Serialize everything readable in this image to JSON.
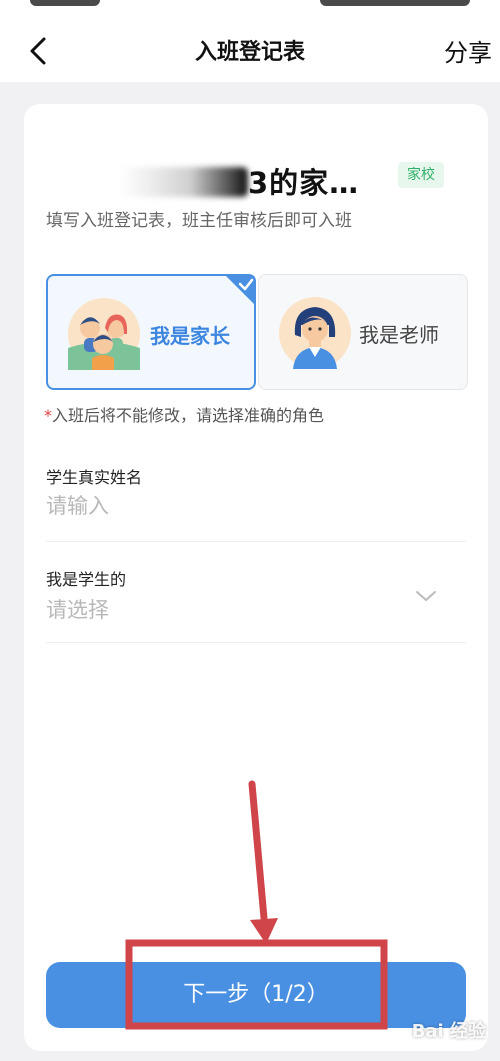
{
  "header": {
    "title": "入班登记表",
    "share_label": "分享"
  },
  "class_info": {
    "name_visible": "3的家…",
    "badge": "家校",
    "subtitle": "填写入班登记表，班主任审核后即可入班"
  },
  "roles": {
    "parent": {
      "label": "我是家长",
      "selected": true
    },
    "teacher": {
      "label": "我是老师",
      "selected": false
    },
    "note_star": "*",
    "note": "入班后将不能修改，请选择准确的角色"
  },
  "form": {
    "student_name_label": "学生真实姓名",
    "student_name_placeholder": "请输入",
    "student_name_value": "",
    "relation_label": "我是学生的",
    "relation_placeholder": "请选择"
  },
  "footer": {
    "next_label": "下一步（1/2）"
  },
  "watermark": "Bai 经验",
  "colors": {
    "primary": "#4a90e2",
    "badge_bg": "#e8f7ee",
    "badge_text": "#2fb06a",
    "annotation_red": "#d0454a",
    "required_star": "#e04040"
  },
  "icons": [
    "back-arrow-icon",
    "check-corner-icon",
    "chevron-down-icon",
    "parent-avatar-icon",
    "teacher-avatar-icon"
  ]
}
